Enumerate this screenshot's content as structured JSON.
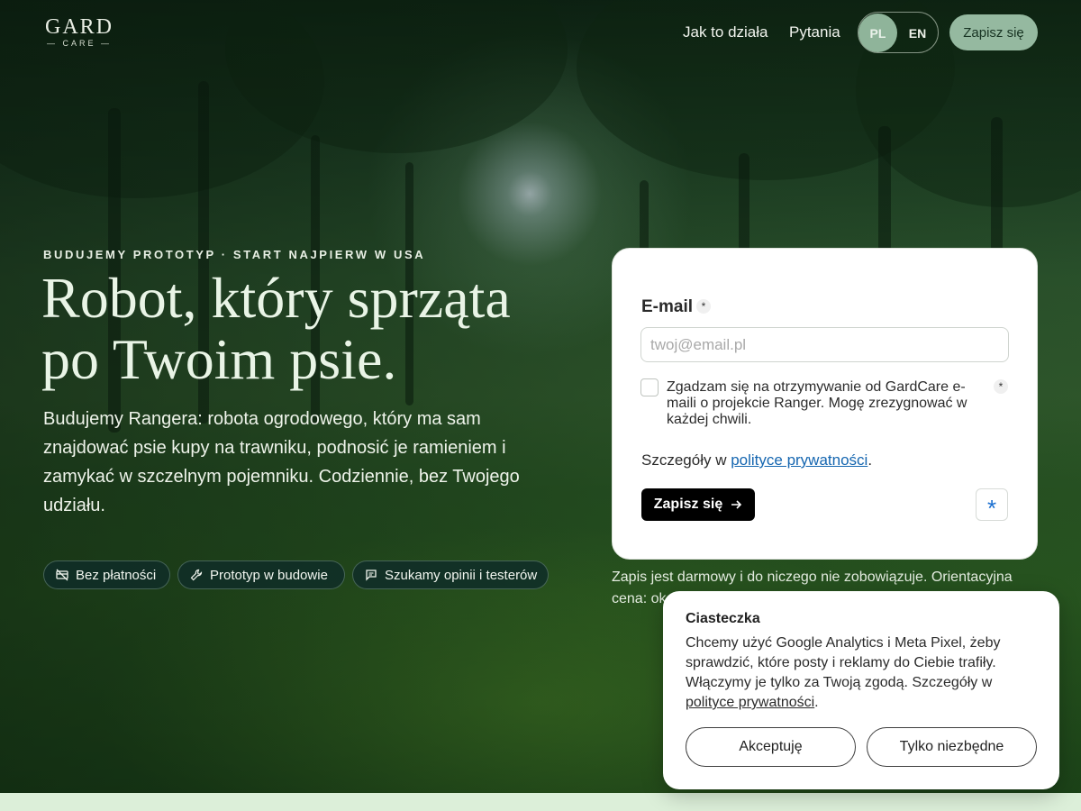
{
  "logo": {
    "main": "GARD",
    "sub": "— CARE —"
  },
  "nav": {
    "how_it_works": "Jak to działa",
    "questions": "Pytania",
    "lang_pl": "PL",
    "lang_en": "EN",
    "signup": "Zapisz się"
  },
  "hero": {
    "eyebrow": "BUDUJEMY PROTOTYP · START NAJPIERW W USA",
    "title_line1": "Robot, który sprząta",
    "title_line2": "po Twoim psie.",
    "description": "Budujemy Rangera: robota ogrodowego, który ma sam znajdować psie kupy na trawniku, podnosić je ramieniem i zamykać w szczelnym pojemniku. Codziennie, bez Twojego udziału.",
    "pills": [
      {
        "label": "Bez płatności",
        "icon": "no-card-icon"
      },
      {
        "label": "Prototyp w budowie",
        "icon": "wrench-icon"
      },
      {
        "label": "Szukamy opinii i testerów",
        "icon": "chat-icon"
      }
    ]
  },
  "form": {
    "email_label": "E-mail",
    "required_mark": "*",
    "email_placeholder": "twoj@email.pl",
    "consent_text": "Zgadzam się na otrzymywanie od GardCare e-maili o projekcie Ranger. Mogę zrezygnować w każdej chwili.",
    "details_prefix": "Szczegóły w ",
    "details_link": "polityce prywatności",
    "details_suffix": ".",
    "submit_label": "Zapisz się",
    "submit_icon": "arrow-right-icon",
    "asterisk_button": "*"
  },
  "note": "Zapis jest darmowy i do niczego nie zobowiązuje. Orientacyjna cena: ok",
  "cookie": {
    "title": "Ciasteczka",
    "text": "Chcemy użyć Google Analytics i Meta Pixel, żeby sprawdzić, które posty i reklamy do Ciebie trafiły. Włączymy je tylko za Twoją zgodą. Szczegóły w ",
    "link": "polityce prywatności",
    "suffix": ".",
    "accept": "Akceptuję",
    "necessary": "Tylko niezbędne"
  },
  "colors": {
    "accent_button": "#95b9a0",
    "link_blue": "#1566b0",
    "bottom_strip": "#dcefd9"
  }
}
